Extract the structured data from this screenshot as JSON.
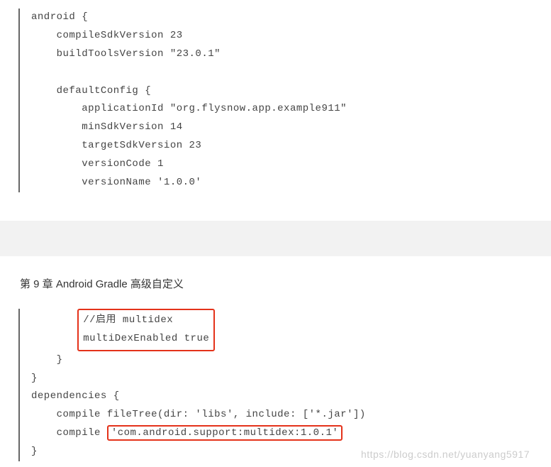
{
  "section1": {
    "lines": [
      "android {",
      "    compileSdkVersion 23",
      "    buildToolsVersion \"23.0.1\"",
      "",
      "    defaultConfig {",
      "        applicationId \"org.flysnow.app.example911\"",
      "        minSdkVersion 14",
      "        targetSdkVersion 23",
      "        versionCode 1",
      "        versionName '1.0.0'"
    ]
  },
  "chapter": {
    "title": "第 9 章   Android  Gradle 高级自定义"
  },
  "section2": {
    "box_line1": "//启用 multidex",
    "box_line2": "multiDexEnabled true",
    "line3": "    }",
    "line4": "}",
    "line5": "dependencies {",
    "line6": "    compile fileTree(dir: 'libs', include: ['*.jar'])",
    "line7_prefix": "    compile ",
    "line7_highlight": "'com.android.support:multidex:1.0.1'",
    "line8": "}"
  },
  "watermark": "https://blog.csdn.net/yuanyang5917"
}
